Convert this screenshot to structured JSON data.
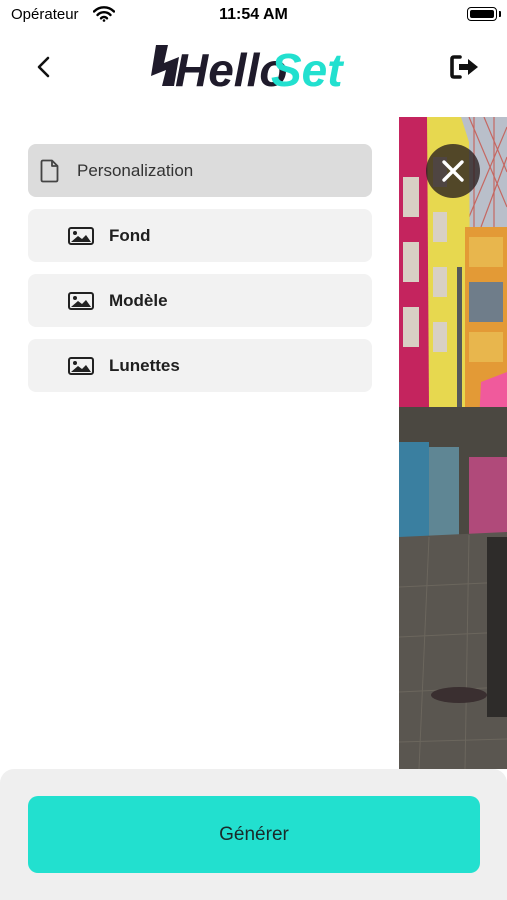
{
  "status": {
    "carrier": "Opérateur",
    "time": "11:54 AM"
  },
  "header": {
    "logo_left": "Hello",
    "logo_right": "Set"
  },
  "menu": {
    "title": "Personalization",
    "items": [
      {
        "label": "Fond",
        "icon": "image-icon"
      },
      {
        "label": "Modèle",
        "icon": "image-icon"
      },
      {
        "label": "Lunettes",
        "icon": "image-icon"
      }
    ]
  },
  "footer": {
    "generate_label": "Générer"
  },
  "colors": {
    "accent": "#22e0cf",
    "logo_dark": "#1f1b2b"
  }
}
